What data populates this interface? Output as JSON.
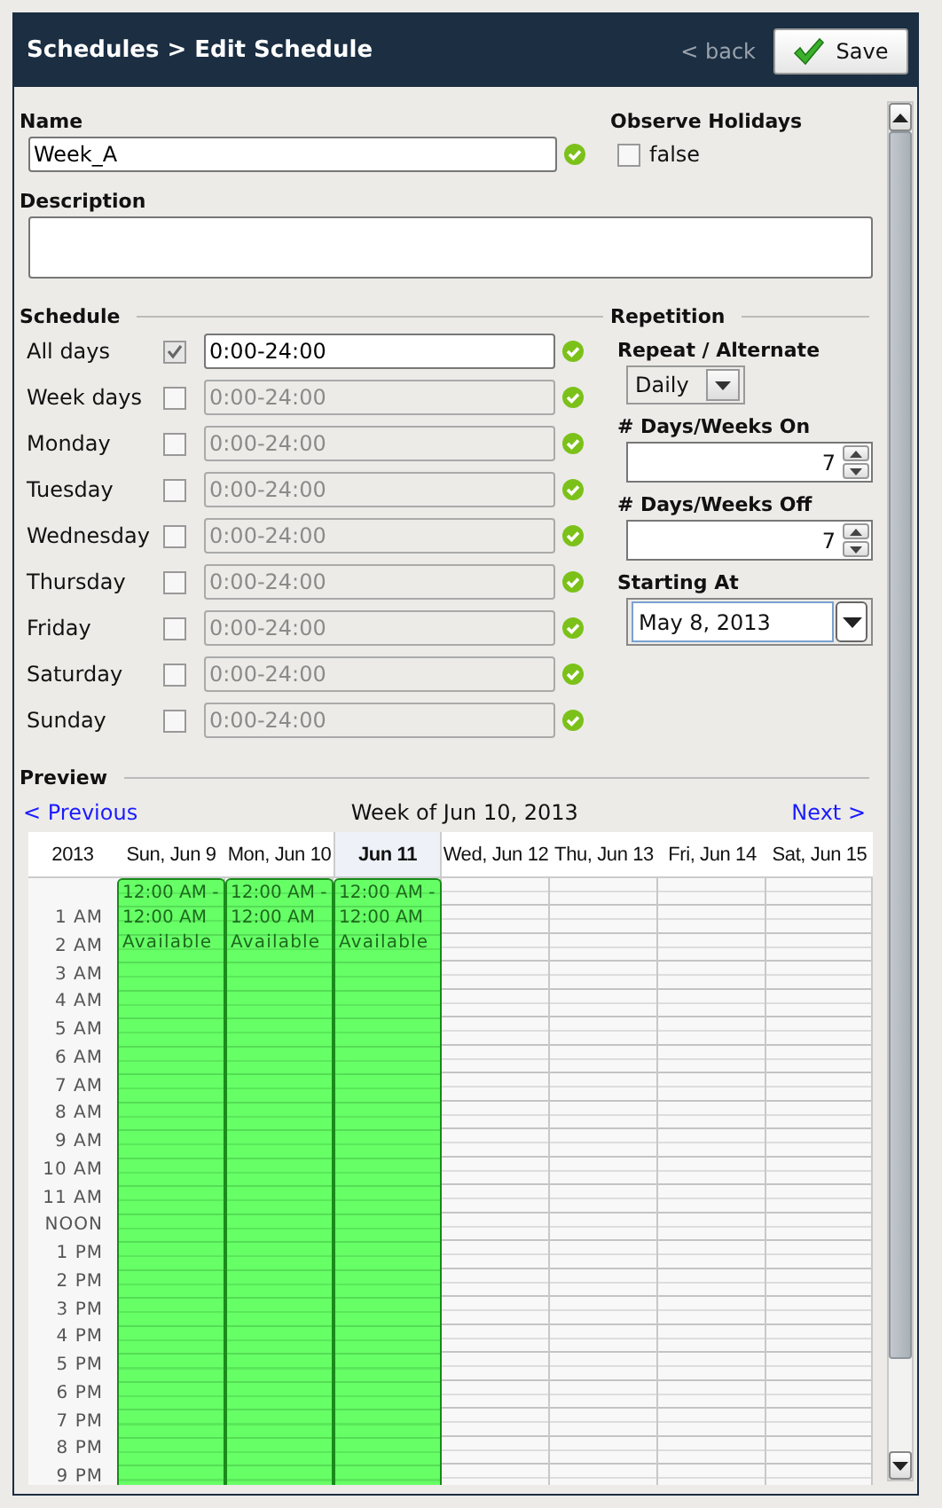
{
  "header": {
    "title": "Schedules > Edit Schedule",
    "back": "< back",
    "save": "Save"
  },
  "name": {
    "label": "Name",
    "value": "Week_A"
  },
  "observe_holidays": {
    "label": "Observe Holidays",
    "checked": false,
    "text": "false"
  },
  "description": {
    "label": "Description"
  },
  "schedule": {
    "label": "Schedule",
    "rows": [
      {
        "day": "All days",
        "checked": true,
        "value": "0:00-24:00"
      },
      {
        "day": "Week days",
        "checked": false,
        "value": "0:00-24:00"
      },
      {
        "day": "Monday",
        "checked": false,
        "value": "0:00-24:00"
      },
      {
        "day": "Tuesday",
        "checked": false,
        "value": "0:00-24:00"
      },
      {
        "day": "Wednesday",
        "checked": false,
        "value": "0:00-24:00"
      },
      {
        "day": "Thursday",
        "checked": false,
        "value": "0:00-24:00"
      },
      {
        "day": "Friday",
        "checked": false,
        "value": "0:00-24:00"
      },
      {
        "day": "Saturday",
        "checked": false,
        "value": "0:00-24:00"
      },
      {
        "day": "Sunday",
        "checked": false,
        "value": "0:00-24:00"
      }
    ]
  },
  "repetition": {
    "label": "Repetition",
    "repeat_label": "Repeat / Alternate",
    "repeat_value": "Daily",
    "on_label": "# Days/Weeks On",
    "on_value": "7",
    "off_label": "# Days/Weeks Off",
    "off_value": "7",
    "start_label": "Starting At",
    "start_value": "May 8, 2013"
  },
  "preview": {
    "label": "Preview",
    "previous": "< Previous",
    "week": "Week of Jun 10, 2013",
    "next": "Next >",
    "year": "2013",
    "days": [
      {
        "label": "Sun, Jun 9",
        "selected": false,
        "event": {
          "start": "12:00 AM -",
          "end": "12:00 AM",
          "title": "Available"
        }
      },
      {
        "label": "Mon, Jun 10",
        "selected": false,
        "event": {
          "start": "12:00 AM -",
          "end": "12:00 AM",
          "title": "Available"
        }
      },
      {
        "label": "Jun 11",
        "selected": true,
        "event": {
          "start": "12:00 AM -",
          "end": "12:00 AM",
          "title": "Available"
        }
      },
      {
        "label": "Wed, Jun 12",
        "selected": false
      },
      {
        "label": "Thu, Jun 13",
        "selected": false
      },
      {
        "label": "Fri, Jun 14",
        "selected": false
      },
      {
        "label": "Sat, Jun 15",
        "selected": false
      }
    ],
    "hours": [
      "1 AM",
      "2 AM",
      "3 AM",
      "4 AM",
      "5 AM",
      "6 AM",
      "7 AM",
      "8 AM",
      "9 AM",
      "10 AM",
      "11 AM",
      "NOON",
      "1 PM",
      "2 PM",
      "3 PM",
      "4 PM",
      "5 PM",
      "6 PM",
      "7 PM",
      "8 PM",
      "9 PM"
    ]
  }
}
